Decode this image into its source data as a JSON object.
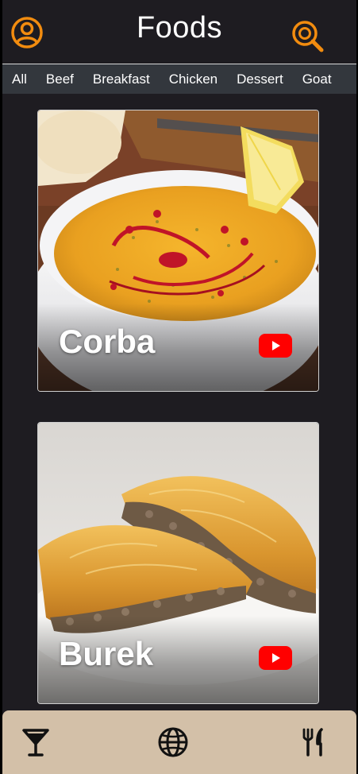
{
  "header": {
    "title": "Foods"
  },
  "icons": {
    "profile": "user-circle-icon",
    "search": "search-icon",
    "video": "youtube-icon",
    "nav": [
      "cocktail-icon",
      "globe-icon",
      "fork-knife-icon"
    ]
  },
  "colors": {
    "accent": "#f28c0f",
    "background": "#1e1c21",
    "tab_bar": "#33373d",
    "bottom_nav": "#d3c0a8",
    "youtube": "#ff0000"
  },
  "categories": [
    "All",
    "Beef",
    "Breakfast",
    "Chicken",
    "Dessert",
    "Goat"
  ],
  "meals": [
    {
      "name": "Corba"
    },
    {
      "name": "Burek"
    }
  ]
}
